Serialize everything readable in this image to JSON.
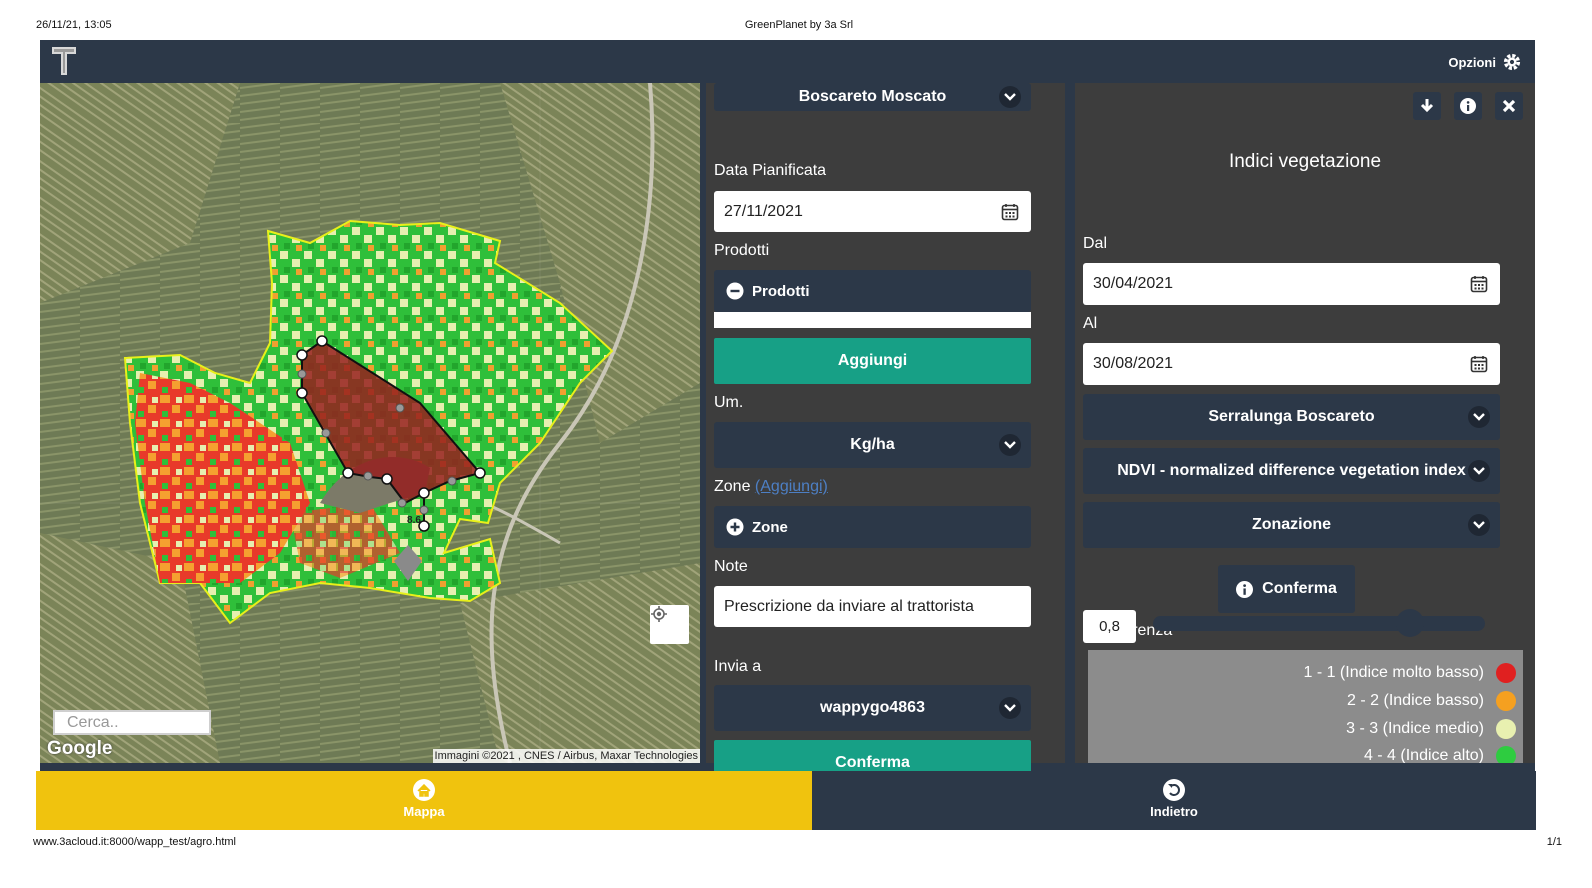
{
  "print": {
    "datetime": "26/11/21, 13:05",
    "title": "GreenPlanet by 3a Srl",
    "url": "www.3acloud.it:8000/wapp_test/agro.html",
    "page": "1/1"
  },
  "topbar": {
    "options_label": "Opzioni"
  },
  "map": {
    "search_placeholder": "Cerca..",
    "brand": "Google",
    "copyright": "Immagini ©2021 , CNES / Airbus, Maxar Technologies",
    "marker_value": "8.6"
  },
  "prescription": {
    "field_select": "Boscareto Moscato",
    "date_label": "Data Pianificata",
    "date_value": "27/11/2021",
    "products_label": "Prodotti",
    "products_toggle": "Prodotti",
    "add_button": "Aggiungi",
    "unit_label": "Um.",
    "unit_value": "Kg/ha",
    "zones_label": "Zone",
    "zones_add_link": "(Aggiungi)",
    "zones_toggle": "Zone",
    "note_label": "Note",
    "note_value": "Prescrizione da inviare al trattorista",
    "send_to_label": "Invia a",
    "send_to_value": "wappygo4863",
    "confirm_button": "Conferma"
  },
  "vegetation": {
    "title": "Indici vegetazione",
    "from_label": "Dal",
    "from_value": "30/04/2021",
    "to_label": "Al",
    "to_value": "30/08/2021",
    "field_select": "Serralunga Boscareto",
    "index_select": "NDVI - normalized difference vegetation index",
    "mode_select": "Zonazione",
    "confirm_button": "Conferma",
    "transparency_label": "Trasparenza",
    "transparency_value": "0,8",
    "transparency_level": 0.8,
    "legend": [
      {
        "label": "1 - 1 (Indice molto basso)",
        "color": "#e02020"
      },
      {
        "label": "2 - 2 (Indice basso)",
        "color": "#f5a020"
      },
      {
        "label": "3 - 3 (Indice medio)",
        "color": "#e8f0b0"
      },
      {
        "label": "4 - 4 (Indice alto)",
        "color": "#2ecc40"
      }
    ]
  },
  "bottom_nav": {
    "map_label": "Mappa",
    "back_label": "Indietro"
  },
  "colors": {
    "navbar": "#2c3848",
    "panel": "#3d3d3d",
    "accent_teal": "#17a086",
    "active_tab": "#f0c30e"
  }
}
